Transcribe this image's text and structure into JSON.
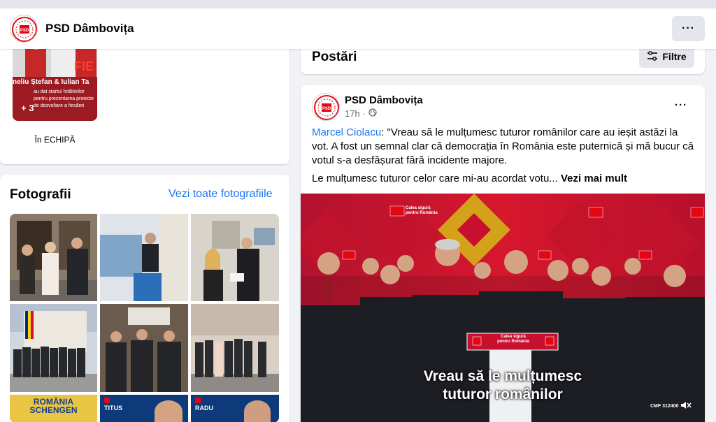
{
  "header": {
    "page_name": "PSD Dâmbovița",
    "more_label": "···"
  },
  "team": {
    "label": "În ECHIPĂ",
    "thumb_plus": "+ 3",
    "thumb_names": "neliu Ștefan & Iulian Ta",
    "thumb_fie": "FIE",
    "thumb_sub1": "au dat startul întâlnirilor",
    "thumb_sub2": "pentru prezentarea proiecte",
    "thumb_sub3": "de dezvoltare a fiecărei"
  },
  "photos": {
    "title": "Fotografii",
    "see_all": "Vezi toate fotografiile",
    "tile_text_romania": "ROMÂNIA",
    "tile_text_schengen": "SCHENGEN",
    "tile_text_titus": "TITUS",
    "tile_text_radu": "RADU"
  },
  "posts": {
    "title": "Postări",
    "filter_label": "Filtre"
  },
  "post": {
    "author": "PSD Dâmbovița",
    "time": "17h",
    "more_label": "···",
    "mention": "Marcel Ciolacu",
    "text1": ": \"Vreau să le mulțumesc tuturor românilor care au ieșit astăzi la vot. A fost un semnal clar că democrația în România este puternică și mă bucur că votul s-a desfășurat fără incidente majore.",
    "text2": "Le mulțumesc tuturor celor care mi-au acordat votu...",
    "see_more": "Vezi mai mult",
    "video_line1": "Vreau să le mulțumesc",
    "video_line2": "tuturor românilor",
    "watermark": "CMF 312400",
    "banner": "Calea sigură pentru România",
    "podium_line1": "Calea sigură",
    "podium_line2": "pentru România"
  },
  "colors": {
    "accent": "#1877f2",
    "psd_red": "#e30613",
    "brand_gold": "#d4a21a"
  }
}
